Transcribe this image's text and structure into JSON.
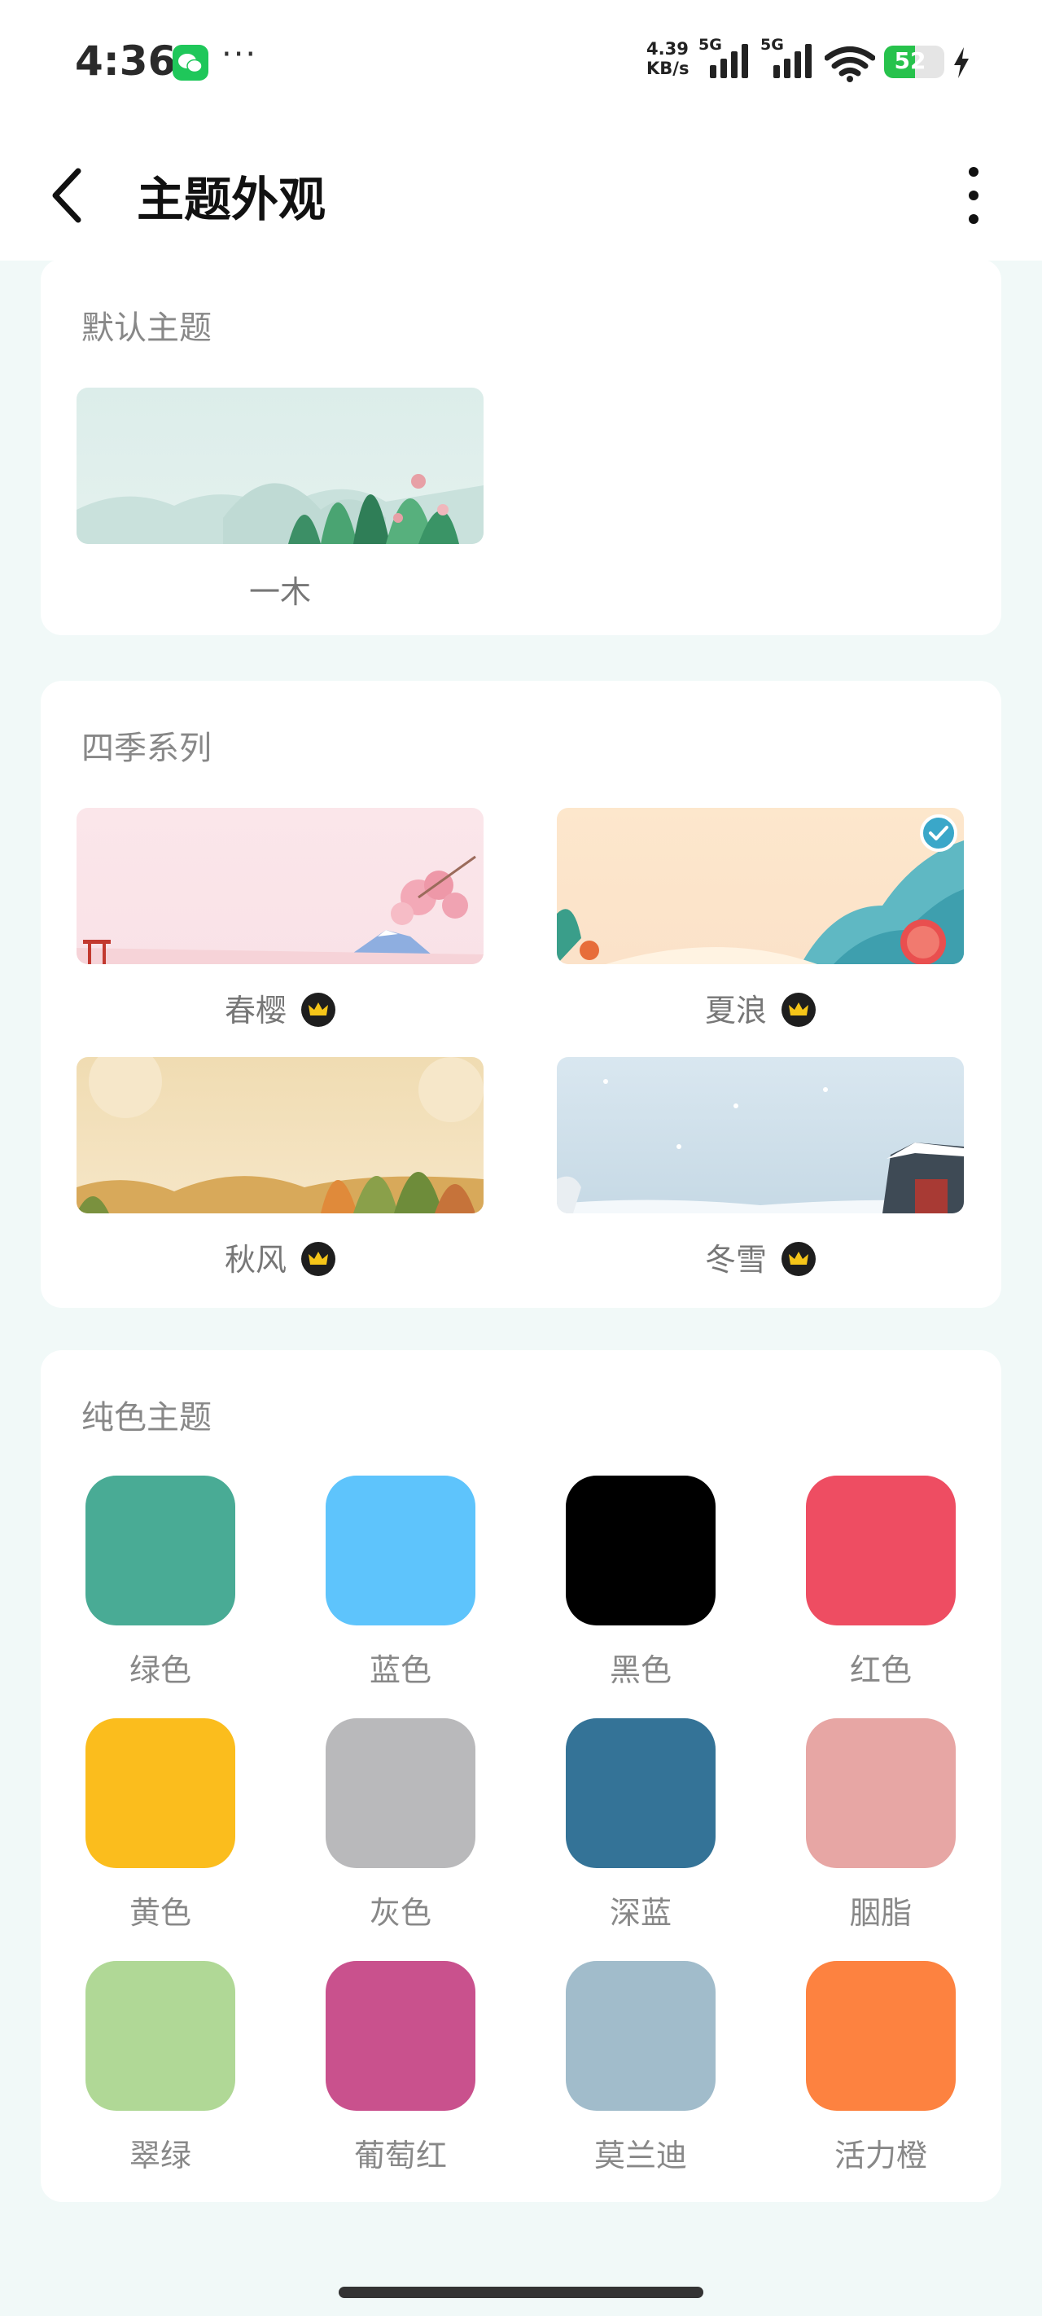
{
  "status_bar": {
    "time": "4:36",
    "net_speed_value": "4.39",
    "net_speed_unit": "KB/s",
    "signal1_label": "5G",
    "signal2_label": "5G",
    "battery_level": "52",
    "battery_fraction": 0.52
  },
  "header": {
    "title": "主题外观"
  },
  "default_section": {
    "title": "默认主题",
    "themes": [
      {
        "label": "一木"
      }
    ]
  },
  "seasons_section": {
    "title": "四季系列",
    "themes": [
      {
        "label": "春樱",
        "premium": true,
        "selected": false
      },
      {
        "label": "夏浪",
        "premium": true,
        "selected": true
      },
      {
        "label": "秋风",
        "premium": true,
        "selected": false
      },
      {
        "label": "冬雪",
        "premium": true,
        "selected": false
      }
    ]
  },
  "solid_section": {
    "title": "纯色主题",
    "colors": [
      {
        "label": "绿色",
        "color": "#49ab95"
      },
      {
        "label": "蓝色",
        "color": "#5ec4fc"
      },
      {
        "label": "黑色",
        "color": "#000000"
      },
      {
        "label": "红色",
        "color": "#ee4d62"
      },
      {
        "label": "黄色",
        "color": "#fbbd1d"
      },
      {
        "label": "灰色",
        "color": "#b9b9bb"
      },
      {
        "label": "深蓝",
        "color": "#347397"
      },
      {
        "label": "胭脂",
        "color": "#e7a6a4"
      },
      {
        "label": "翠绿",
        "color": "#b0d896"
      },
      {
        "label": "葡萄红",
        "color": "#c9518d"
      },
      {
        "label": "莫兰迪",
        "color": "#a1bccb"
      },
      {
        "label": "活力橙",
        "color": "#fd8240"
      }
    ]
  },
  "icons": {
    "back": "chevron-left-icon",
    "menu": "more-vertical-icon",
    "crown": "crown-icon",
    "check": "check-icon"
  }
}
